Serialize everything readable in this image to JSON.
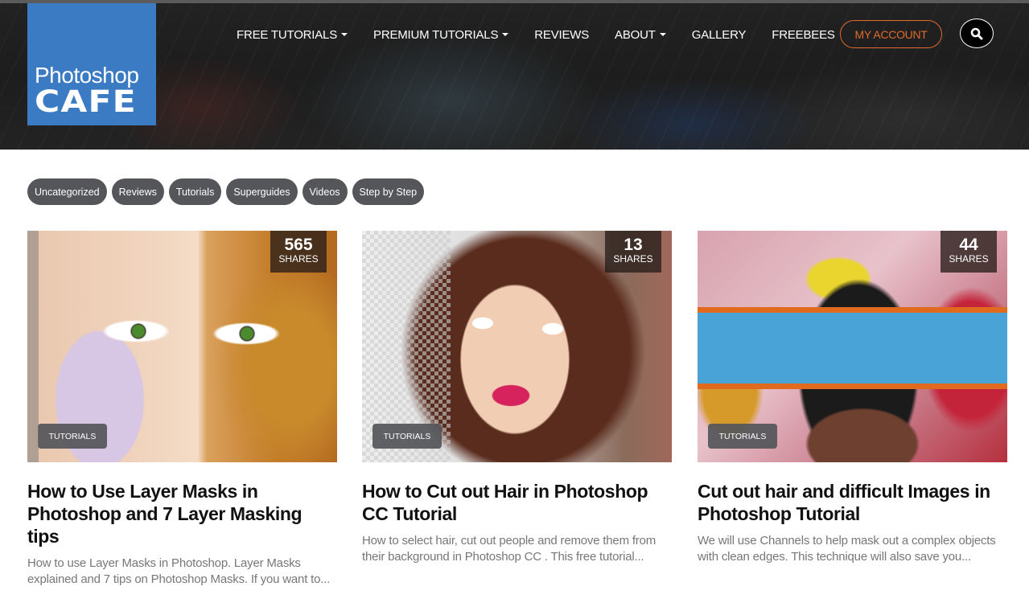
{
  "brand": {
    "line1": "Photoshop",
    "line2": "CAFE",
    "color": "#3a7bc3"
  },
  "nav": {
    "items": [
      {
        "label": "FREE TUTORIALS",
        "has_dropdown": true
      },
      {
        "label": "PREMIUM TUTORIALS",
        "has_dropdown": true
      },
      {
        "label": "REVIEWS",
        "has_dropdown": false
      },
      {
        "label": "ABOUT",
        "has_dropdown": true
      },
      {
        "label": "GALLERY",
        "has_dropdown": false
      },
      {
        "label": "FREEBEES",
        "has_dropdown": false
      }
    ],
    "account_label": "MY ACCOUNT",
    "account_color": "#e06b2a",
    "search_icon": "search-icon"
  },
  "categories": [
    "Uncategorized",
    "Reviews",
    "Tutorials",
    "Superguides",
    "Videos",
    "Step by Step"
  ],
  "posts": [
    {
      "shares": "565",
      "shares_label": "SHARES",
      "category": "TUTORIALS",
      "title": "How to Use Layer Masks in Photoshop and 7 Layer Masking tips",
      "excerpt": "How to use Layer Masks in Photoshop. Layer Masks explained and 7 tips on Photoshop Masks. If you want to..."
    },
    {
      "shares": "13",
      "shares_label": "SHARES",
      "category": "TUTORIALS",
      "title": "How to Cut out Hair in Photoshop CC Tutorial",
      "excerpt": "How to select hair, cut out people and remove them from their background in Photoshop CC . This free tutorial..."
    },
    {
      "shares": "44",
      "shares_label": "SHARES",
      "category": "TUTORIALS",
      "title": "Cut out hair and difficult Images in Photoshop Tutorial",
      "excerpt": "We will use Channels to help mask out a complex objects with clean edges. This technique will also save you..."
    }
  ]
}
